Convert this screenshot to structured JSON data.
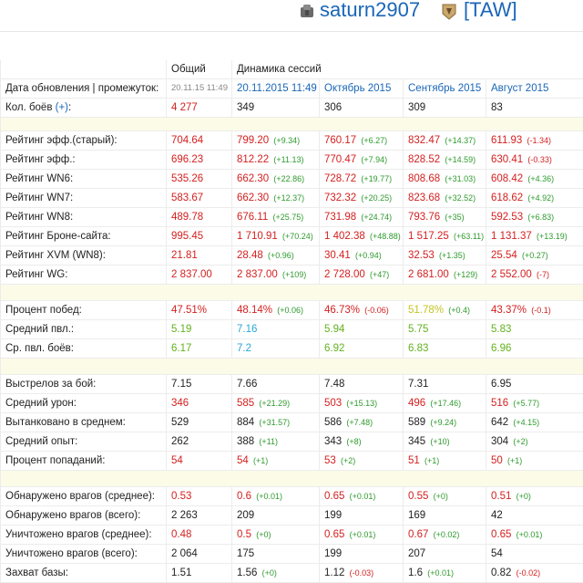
{
  "header": {
    "player": "saturn2907",
    "clan": "[TAW]"
  },
  "columns": {
    "general": "Общий",
    "dynamics": "Динамика сессий"
  },
  "date_row": {
    "label": "Дата обновления | промежуток:",
    "general": "20.11.15 11:49",
    "s1": "20.11.2015 11:49",
    "s2": "Октябрь 2015",
    "s3": "Сентябрь 2015",
    "s4": "Август 2015"
  },
  "battles_row": {
    "label": "Кол. боёв",
    "plus_link": "(+)",
    "suffix": ":",
    "general": "4 277",
    "s1": "349",
    "s2": "306",
    "s3": "309",
    "s4": "83"
  },
  "rows": [
    {
      "label": "Рейтинг эфф.(старый):",
      "general": "704.64",
      "g": "red",
      "vals": [
        [
          "799.20",
          "(+9.34)",
          "p",
          "red"
        ],
        [
          "760.17",
          "(+6.27)",
          "p",
          "red"
        ],
        [
          "832.47",
          "(+14.37)",
          "p",
          "red"
        ],
        [
          "611.93",
          "(-1.34)",
          "n",
          "red"
        ]
      ]
    },
    {
      "label": "Рейтинг эфф.:",
      "general": "696.23",
      "g": "red",
      "vals": [
        [
          "812.22",
          "(+11.13)",
          "p",
          "red"
        ],
        [
          "770.47",
          "(+7.94)",
          "p",
          "red"
        ],
        [
          "828.52",
          "(+14.59)",
          "p",
          "red"
        ],
        [
          "630.41",
          "(-0.33)",
          "n",
          "red"
        ]
      ]
    },
    {
      "label": "Рейтинг WN6:",
      "general": "535.26",
      "g": "red",
      "vals": [
        [
          "662.30",
          "(+22.86)",
          "p",
          "red"
        ],
        [
          "728.72",
          "(+19.77)",
          "p",
          "red"
        ],
        [
          "808.68",
          "(+31.03)",
          "p",
          "red"
        ],
        [
          "608.42",
          "(+4.36)",
          "p",
          "red"
        ]
      ]
    },
    {
      "label": "Рейтинг WN7:",
      "general": "583.67",
      "g": "red",
      "vals": [
        [
          "662.30",
          "(+12.37)",
          "p",
          "red"
        ],
        [
          "732.32",
          "(+20.25)",
          "p",
          "red"
        ],
        [
          "823.68",
          "(+32.52)",
          "p",
          "red"
        ],
        [
          "618.62",
          "(+4.92)",
          "p",
          "red"
        ]
      ]
    },
    {
      "label": "Рейтинг WN8:",
      "general": "489.78",
      "g": "red",
      "vals": [
        [
          "676.11",
          "(+25.75)",
          "p",
          "red"
        ],
        [
          "731.98",
          "(+24.74)",
          "p",
          "red"
        ],
        [
          "793.76",
          "(+35)",
          "p",
          "red"
        ],
        [
          "592.53",
          "(+6.83)",
          "p",
          "red"
        ]
      ]
    },
    {
      "label": "Рейтинг Броне-сайта:",
      "general": "995.45",
      "g": "red",
      "vals": [
        [
          "1 710.91",
          "(+70.24)",
          "p",
          "red"
        ],
        [
          "1 402.38",
          "(+48.88)",
          "p",
          "red"
        ],
        [
          "1 517.25",
          "(+63.11)",
          "p",
          "red"
        ],
        [
          "1 131.37",
          "(+13.19)",
          "p",
          "red"
        ]
      ]
    },
    {
      "label": "Рейтинг XVM (WN8):",
      "general": "21.81",
      "g": "red",
      "vals": [
        [
          "28.48",
          "(+0.96)",
          "p",
          "red"
        ],
        [
          "30.41",
          "(+0.94)",
          "p",
          "red"
        ],
        [
          "32.53",
          "(+1.35)",
          "p",
          "red"
        ],
        [
          "25.54",
          "(+0.27)",
          "p",
          "red"
        ]
      ]
    },
    {
      "label": "Рейтинг WG:",
      "general": "2 837.00",
      "g": "red",
      "vals": [
        [
          "2 837.00",
          "(+109)",
          "p",
          "red"
        ],
        [
          "2 728.00",
          "(+47)",
          "p",
          "red"
        ],
        [
          "2 681.00",
          "(+129)",
          "p",
          "red"
        ],
        [
          "2 552.00",
          "(-7)",
          "n",
          "red"
        ]
      ]
    },
    {
      "sep": true
    },
    {
      "label": "Процент побед:",
      "general": "47.51%",
      "g": "red",
      "vals": [
        [
          "48.14%",
          "(+0.06)",
          "p",
          "red"
        ],
        [
          "46.73%",
          "(-0.06)",
          "n",
          "red"
        ],
        [
          "51.78%",
          "(+0.4)",
          "p",
          "yellow"
        ],
        [
          "43.37%",
          "(-0.1)",
          "n",
          "red"
        ]
      ]
    },
    {
      "label": "Средний пвл.:",
      "general": "5.19",
      "g": "lgreen",
      "vals": [
        [
          "7.16",
          "",
          "",
          "cyan"
        ],
        [
          "5.94",
          "",
          "",
          "lgreen"
        ],
        [
          "5.75",
          "",
          "",
          "lgreen"
        ],
        [
          "5.83",
          "",
          "",
          "lgreen"
        ]
      ]
    },
    {
      "label": "Ср. пвл. боёв:",
      "general": "6.17",
      "g": "lgreen",
      "vals": [
        [
          "7.2",
          "",
          "",
          "cyan"
        ],
        [
          "6.92",
          "",
          "",
          "lgreen"
        ],
        [
          "6.83",
          "",
          "",
          "lgreen"
        ],
        [
          "6.96",
          "",
          "",
          "lgreen"
        ]
      ]
    },
    {
      "sep": true
    },
    {
      "label": "Выстрелов за бой:",
      "general": "7.15",
      "g": "dark",
      "vals": [
        [
          "7.66",
          "",
          "",
          "dark"
        ],
        [
          "7.48",
          "",
          "",
          "dark"
        ],
        [
          "7.31",
          "",
          "",
          "dark"
        ],
        [
          "6.95",
          "",
          "",
          "dark"
        ]
      ]
    },
    {
      "label": "Средний урон:",
      "general": "346",
      "g": "red",
      "vals": [
        [
          "585",
          "(+21.29)",
          "p",
          "red"
        ],
        [
          "503",
          "(+15.13)",
          "p",
          "red"
        ],
        [
          "496",
          "(+17.46)",
          "p",
          "red"
        ],
        [
          "516",
          "(+5.77)",
          "p",
          "red"
        ]
      ]
    },
    {
      "label": "Вытанковано в среднем:",
      "general": "529",
      "g": "dark",
      "vals": [
        [
          "884",
          "(+31.57)",
          "p",
          "dark"
        ],
        [
          "586",
          "(+7.48)",
          "p",
          "dark"
        ],
        [
          "589",
          "(+9.24)",
          "p",
          "dark"
        ],
        [
          "642",
          "(+4.15)",
          "p",
          "dark"
        ]
      ]
    },
    {
      "label": "Средний опыт:",
      "general": "262",
      "g": "dark",
      "vals": [
        [
          "388",
          "(+11)",
          "p",
          "dark"
        ],
        [
          "343",
          "(+8)",
          "p",
          "dark"
        ],
        [
          "345",
          "(+10)",
          "p",
          "dark"
        ],
        [
          "304",
          "(+2)",
          "p",
          "dark"
        ]
      ]
    },
    {
      "label": "Процент попаданий:",
      "general": "54",
      "g": "red",
      "vals": [
        [
          "54",
          "(+1)",
          "p",
          "red"
        ],
        [
          "53",
          "(+2)",
          "p",
          "red"
        ],
        [
          "51",
          "(+1)",
          "p",
          "red"
        ],
        [
          "50",
          "(+1)",
          "p",
          "red"
        ]
      ]
    },
    {
      "sep": true
    },
    {
      "label": "Обнаружено врагов (среднее):",
      "general": "0.53",
      "g": "red",
      "vals": [
        [
          "0.6",
          "(+0.01)",
          "p",
          "red"
        ],
        [
          "0.65",
          "(+0.01)",
          "p",
          "red"
        ],
        [
          "0.55",
          "(+0)",
          "p",
          "red"
        ],
        [
          "0.51",
          "(+0)",
          "p",
          "red"
        ]
      ]
    },
    {
      "label": "Обнаружено врагов (всего):",
      "general": "2 263",
      "g": "dark",
      "vals": [
        [
          "209",
          "",
          "",
          "dark"
        ],
        [
          "199",
          "",
          "",
          "dark"
        ],
        [
          "169",
          "",
          "",
          "dark"
        ],
        [
          "42",
          "",
          "",
          "dark"
        ]
      ]
    },
    {
      "label": "Уничтожено врагов (среднее):",
      "general": "0.48",
      "g": "red",
      "vals": [
        [
          "0.5",
          "(+0)",
          "p",
          "red"
        ],
        [
          "0.65",
          "(+0.01)",
          "p",
          "red"
        ],
        [
          "0.67",
          "(+0.02)",
          "p",
          "red"
        ],
        [
          "0.65",
          "(+0.01)",
          "p",
          "red"
        ]
      ]
    },
    {
      "label": "Уничтожено врагов (всего):",
      "general": "2 064",
      "g": "dark",
      "vals": [
        [
          "175",
          "",
          "",
          "dark"
        ],
        [
          "199",
          "",
          "",
          "dark"
        ],
        [
          "207",
          "",
          "",
          "dark"
        ],
        [
          "54",
          "",
          "",
          "dark"
        ]
      ]
    },
    {
      "label": "Захват базы:",
      "general": "1.51",
      "g": "dark",
      "vals": [
        [
          "1.56",
          "(+0)",
          "p",
          "dark"
        ],
        [
          "1.12",
          "(-0.03)",
          "n",
          "dark"
        ],
        [
          "1.6",
          "(+0.01)",
          "p",
          "dark"
        ],
        [
          "0.82",
          "(-0.02)",
          "n",
          "dark"
        ]
      ]
    }
  ]
}
